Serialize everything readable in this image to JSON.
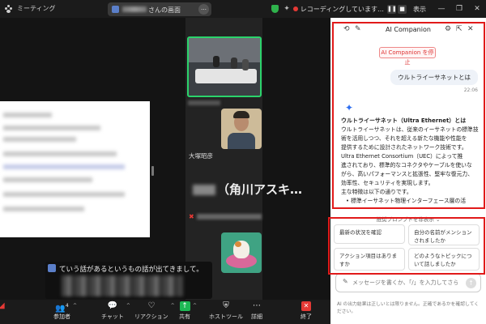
{
  "titlebar": {
    "app_title": "ミーティング",
    "share_label": "さんの画面",
    "more_icon": "…",
    "recording_text": "レコーディングしています…",
    "view_label": "表示",
    "minimize": "—",
    "maximize": "❐",
    "close": "✕"
  },
  "main": {
    "participant_name": "大塚昭彦",
    "big_name": "（角川アスキ…",
    "caption_text": "ていう話があるというもの話が出てきまして。"
  },
  "toolbar": {
    "participants_label": "参加者",
    "participants_count": "4",
    "chat_label": "チャット",
    "reactions_label": "リアクション",
    "share_label": "共有",
    "host_tools_label": "ホストツール",
    "more_label": "詳細",
    "end_label": "終了"
  },
  "ai": {
    "title": "AI Companion",
    "stop_button": "AI Companion を停止",
    "user_message": "ウルトライーサネットとは",
    "message_time": "22:06",
    "response": {
      "heading": "ウルトライーサネット（Ultra Ethernet）とは",
      "lines": [
        "ウルトライーサネットは、従来のイーサネットの標準技",
        "術を活用しつつ、それを超える新たな機能や性能を",
        "提供するために設計されたネットワーク技術です。",
        "Ultra Ethernet Consortium（UEC）によって推",
        "進されており、標準的なコネクタやケーブルを使いな",
        "がら、高いパフォーマンスと拡張性、堅牢な復元力、",
        "効率性、セキュリティを実現します。",
        "主な特徴は以下の通りです。"
      ],
      "bullet": "標準イーサネット物理インターフェース層の活"
    },
    "hide_prompts": "推奨プロンプトを非表示 ⌄",
    "suggestions": [
      "最新の状況を確認",
      "自分の名前がメンションされましたか",
      "アクション項目はありますか",
      "どのようなトピックについて話しましたか"
    ],
    "input_placeholder": "メッセージを書くか、「/」を入力してさらに…",
    "disclaimer": "AI の出力結果は正しいとは限りません。正確であるかを確認してください。"
  }
}
